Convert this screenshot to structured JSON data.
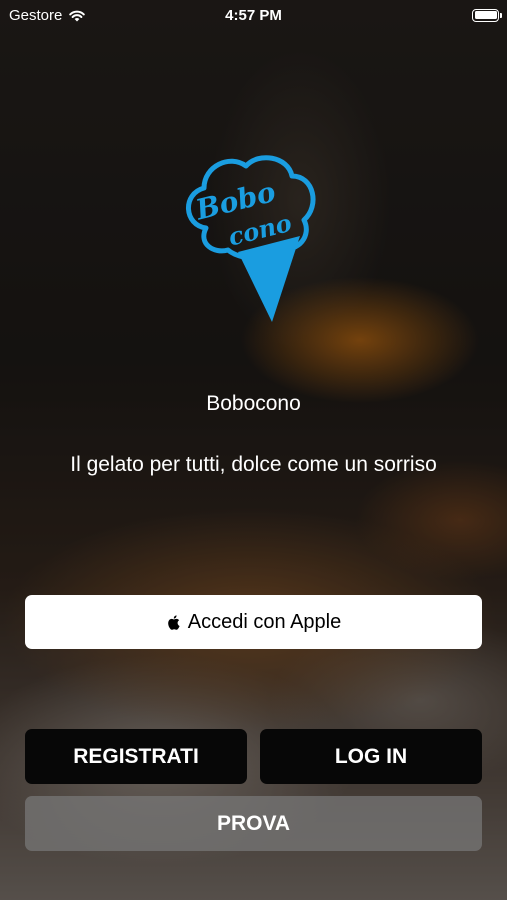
{
  "status_bar": {
    "carrier": "Gestore",
    "time": "4:57 PM",
    "icons": [
      "wifi-icon",
      "battery-icon"
    ]
  },
  "logo": {
    "lettering": "Bobo cono",
    "color": "#1a9de0"
  },
  "app_name": "Bobocono",
  "tagline": "Il gelato per tutti, dolce come un sorriso",
  "buttons": {
    "apple_signin": "Accedi con Apple",
    "apple_icon": "apple-logo-icon",
    "register": "REGISTRATI",
    "login": "LOG IN",
    "try": "PROVA"
  },
  "colors": {
    "primary_button_bg": "#070707",
    "secondary_button_bg": "#787878",
    "apple_button_bg": "#ffffff"
  }
}
